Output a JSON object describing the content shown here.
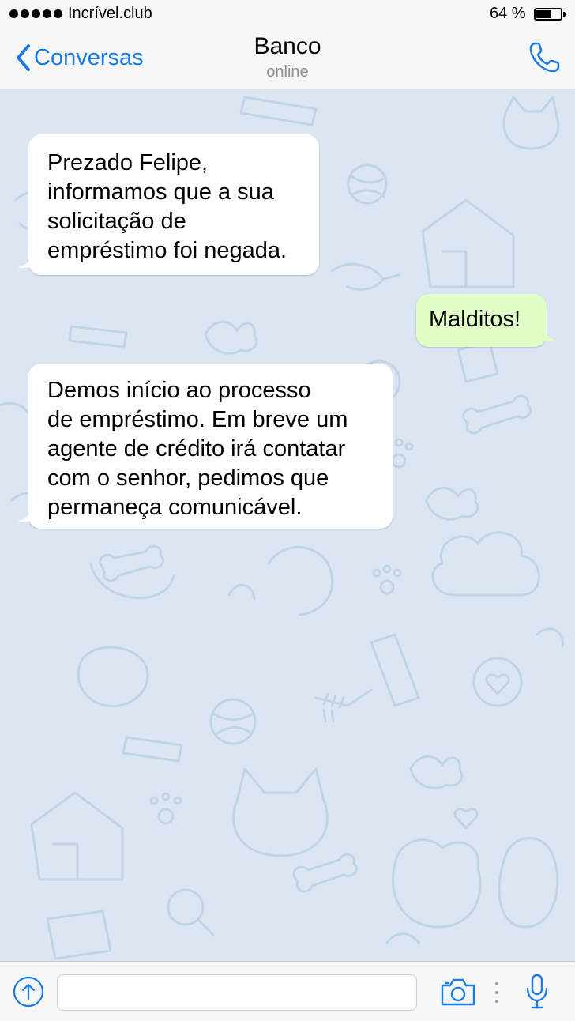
{
  "status_bar": {
    "carrier": "Incrível.club",
    "battery_percent_text": "64 %",
    "battery_level": 0.64
  },
  "nav": {
    "back_label": "Conversas",
    "title": "Banco",
    "subtitle": "online"
  },
  "messages": [
    {
      "direction": "incoming",
      "text": "Prezado Felipe,\ninformamos que a sua\nsolicitação de\nempréstimo foi negada."
    },
    {
      "direction": "outgoing",
      "text": "Malditos!"
    },
    {
      "direction": "incoming",
      "text": "Demos início ao processo\nde empréstimo. Em breve um\nagente de crédito irá contatar\ncom o senhor, pedimos que\npermaneça comunicável."
    }
  ],
  "input_bar": {
    "placeholder": "",
    "icons": [
      "attach-icon",
      "camera-icon",
      "more-icon",
      "microphone-icon"
    ]
  },
  "colors": {
    "accent": "#1a7ce6",
    "chat_background": "#dbe6f2",
    "outgoing_bubble": "#e1fec6",
    "incoming_bubble": "#ffffff"
  }
}
